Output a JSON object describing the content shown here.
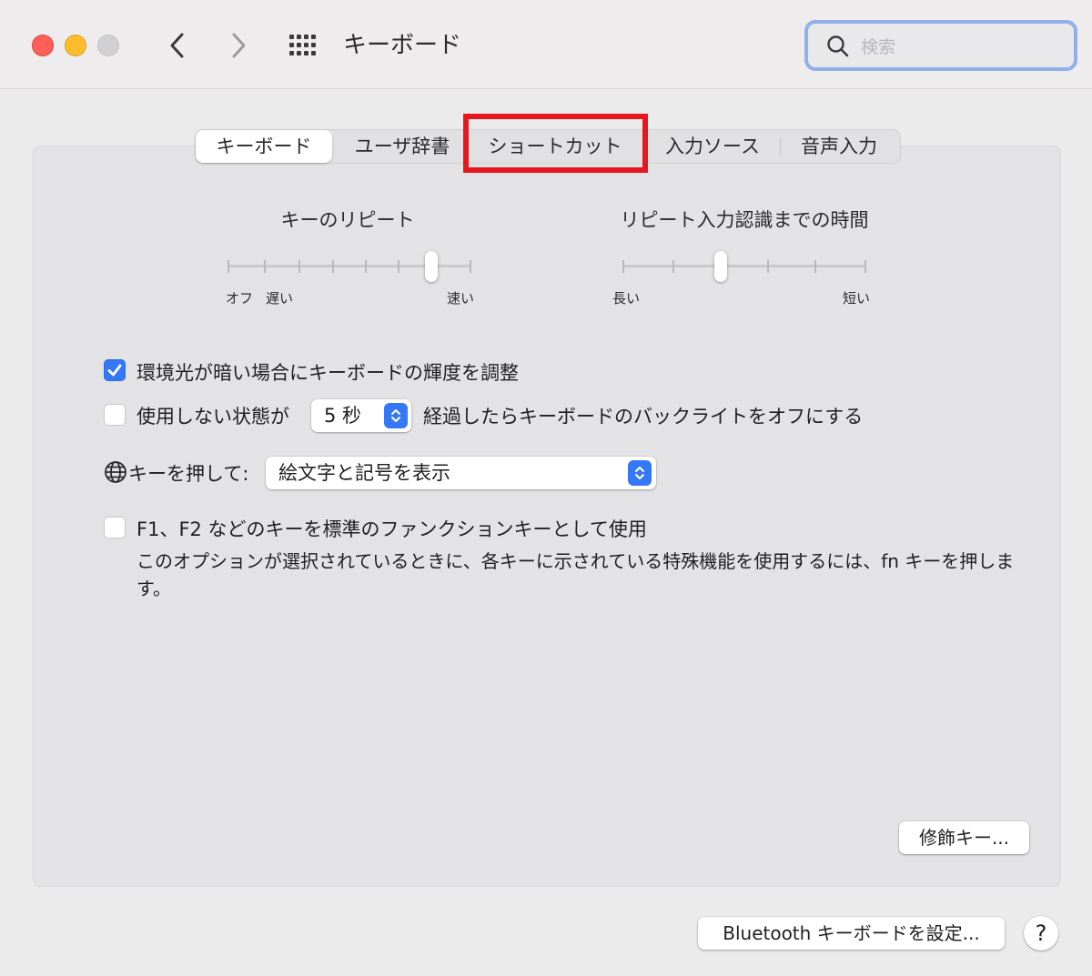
{
  "window": {
    "title": "キーボード",
    "search": {
      "placeholder": "検索"
    }
  },
  "tabs": [
    {
      "label": "キーボード",
      "active": true
    },
    {
      "label": "ユーザ辞書",
      "active": false
    },
    {
      "label": "ショートカット",
      "active": false,
      "highlighted": true
    },
    {
      "label": "入力ソース",
      "active": false
    },
    {
      "label": "音声入力",
      "active": false
    }
  ],
  "key_repeat": {
    "title": "キーのリピート",
    "label_off": "オフ",
    "label_slow": "遅い",
    "label_fast": "速い",
    "ticks": 8,
    "value_index": 6
  },
  "repeat_delay": {
    "title": "リピート入力認識までの時間",
    "label_long": "長い",
    "label_short": "短い",
    "ticks": 6,
    "value_index": 2
  },
  "options": {
    "ambient_light": {
      "label": "環境光が暗い場合にキーボードの輝度を調整",
      "checked": true
    },
    "backlight_off": {
      "label_before": "使用しない状態が",
      "popup_value": "5 秒",
      "label_after": "経過したらキーボードのバックライトをオフにする",
      "checked": false
    },
    "globe_key": {
      "label": "キーを押して:",
      "popup_value": "絵文字と記号を表示"
    },
    "fn_keys": {
      "label": "F1、F2 などのキーを標準のファンクションキーとして使用",
      "description": "このオプションが選択されているときに、各キーに示されている特殊機能を使用するには、fn キーを押します。",
      "checked": false
    }
  },
  "buttons": {
    "modifier_keys": "修飾キー...",
    "bluetooth_setup": "Bluetooth キーボードを設定...",
    "help": "?"
  },
  "colors": {
    "accent": "#3478f6",
    "highlight_box": "#e8161e",
    "traffic_red": "#fe5f58",
    "traffic_yellow": "#febc2e",
    "traffic_gray": "#d1d0d2"
  }
}
